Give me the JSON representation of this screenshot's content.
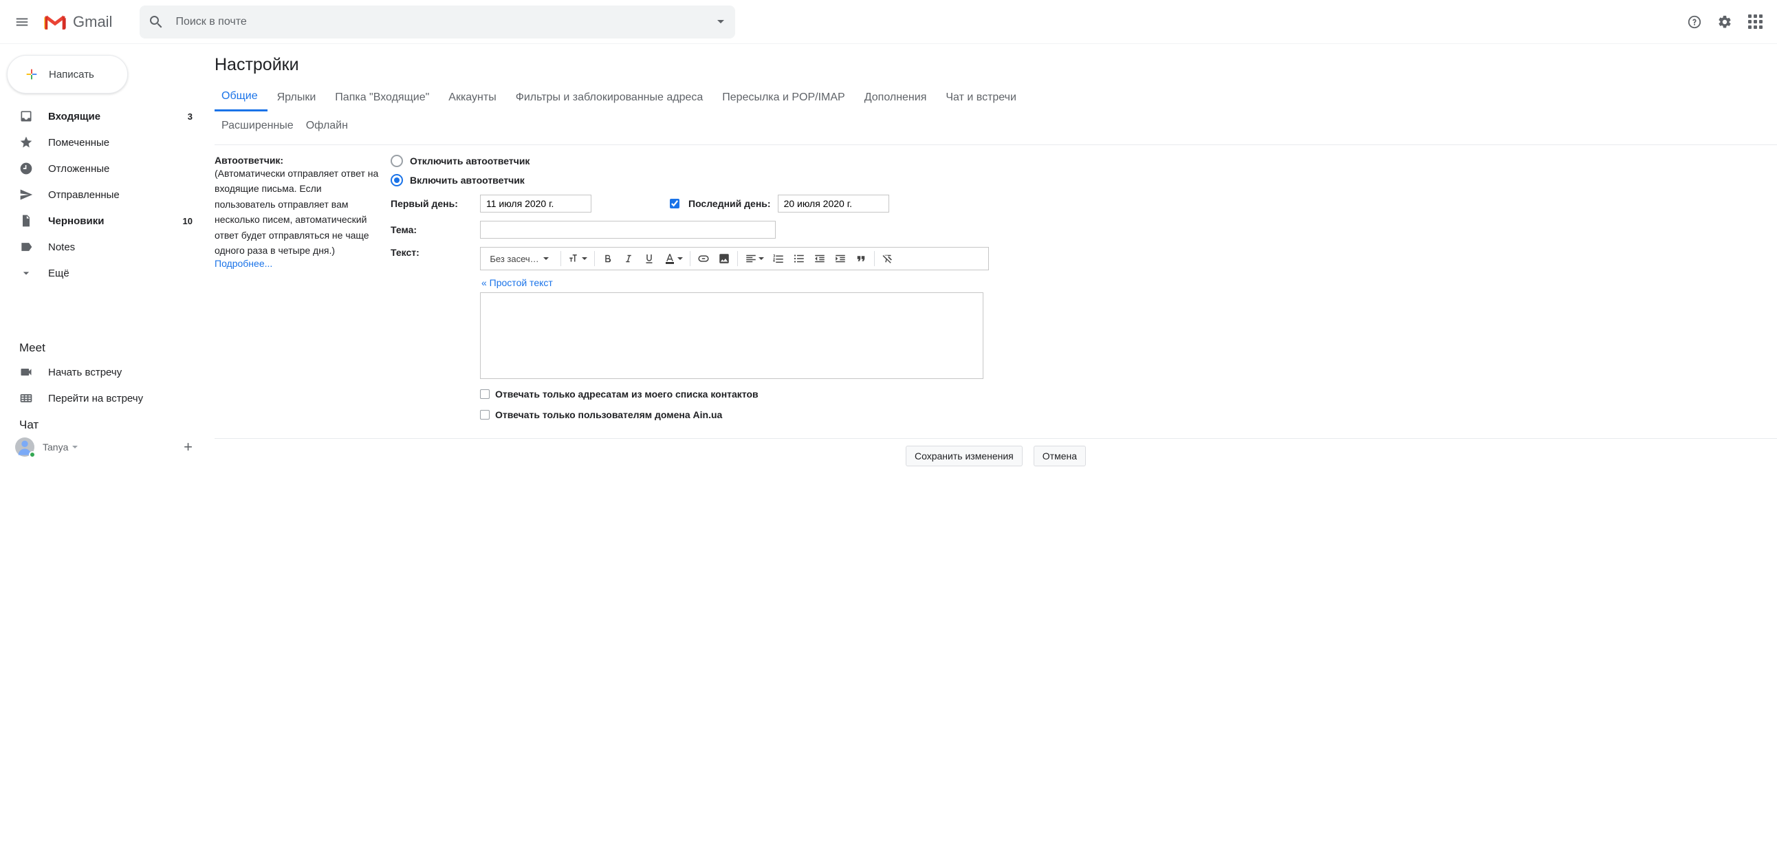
{
  "header": {
    "product": "Gmail",
    "search_placeholder": "Поиск в почте"
  },
  "compose_label": "Написать",
  "sidebar": {
    "items": [
      {
        "label": "Входящие",
        "count": "3",
        "bold": true,
        "icon": "inbox"
      },
      {
        "label": "Помеченные",
        "count": "",
        "bold": false,
        "icon": "star"
      },
      {
        "label": "Отложенные",
        "count": "",
        "bold": false,
        "icon": "clock"
      },
      {
        "label": "Отправленные",
        "count": "",
        "bold": false,
        "icon": "send"
      },
      {
        "label": "Черновики",
        "count": "10",
        "bold": true,
        "icon": "file"
      },
      {
        "label": "Notes",
        "count": "",
        "bold": false,
        "icon": "label"
      },
      {
        "label": "Ещё",
        "count": "",
        "bold": false,
        "icon": "expand"
      }
    ]
  },
  "meet": {
    "header": "Meet",
    "start": "Начать встречу",
    "join": "Перейти на встречу"
  },
  "chat": {
    "header": "Чат",
    "user": "Tanya"
  },
  "settings": {
    "title": "Настройки",
    "tabs": [
      "Общие",
      "Ярлыки",
      "Папка \"Входящие\"",
      "Аккаунты",
      "Фильтры и заблокированные адреса",
      "Пересылка и POP/IMAP",
      "Дополнения",
      "Чат и встречи"
    ],
    "tabs_row2": [
      "Расширенные",
      "Офлайн"
    ]
  },
  "auto": {
    "label": "Автоответчик:",
    "desc": "(Автоматически отправляет ответ на входящие письма. Если пользователь отправляет вам несколько писем, автоматический ответ будет отправляться не чаще одного раза в четыре дня.)",
    "more": "Подробнее...",
    "radio_off": "Отключить автоответчик",
    "radio_on": "Включить автоответчик",
    "first_day_label": "Первый день:",
    "first_day_value": "11 июля 2020 г.",
    "last_day_label": "Последний день:",
    "last_day_value": "20 июля 2020 г.",
    "subject_label": "Тема:",
    "text_label": "Текст:",
    "font_label": "Без засеч…",
    "plain_text": "« Простой текст",
    "contacts_only": "Отвечать только адресатам из моего списка контактов",
    "domain_only": "Отвечать только пользователям домена Ain.ua"
  },
  "footer": {
    "save": "Сохранить изменения",
    "cancel": "Отмена"
  }
}
